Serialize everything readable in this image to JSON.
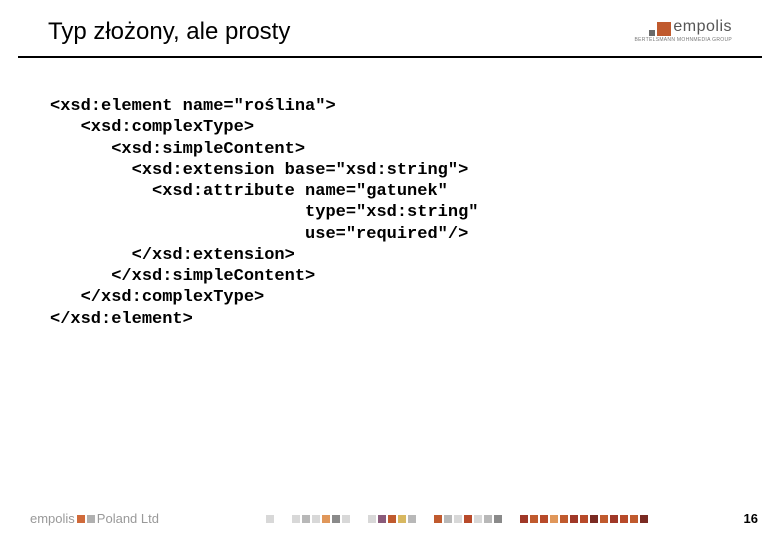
{
  "header": {
    "title": "Typ złożony, ale prosty",
    "logo_text": "empolis",
    "logo_sub": "BERTELSMANN MOHNMEDIA GROUP"
  },
  "code": {
    "l1": "<xsd:element name=\"roślina\">",
    "l2": "   <xsd:complexType>",
    "l3": "      <xsd:simpleContent>",
    "l4": "        <xsd:extension base=\"xsd:string\">",
    "l5": "          <xsd:attribute name=\"gatunek\"",
    "l6": "                         type=\"xsd:string\"",
    "l7": "                         use=\"required\"/>",
    "l8": "        </xsd:extension>",
    "l9": "      </xsd:simpleContent>",
    "l10": "   </xsd:complexType>",
    "l11": "</xsd:element>"
  },
  "footer": {
    "brand1": "empolis",
    "brand2": "Poland Ltd",
    "page": "16"
  }
}
